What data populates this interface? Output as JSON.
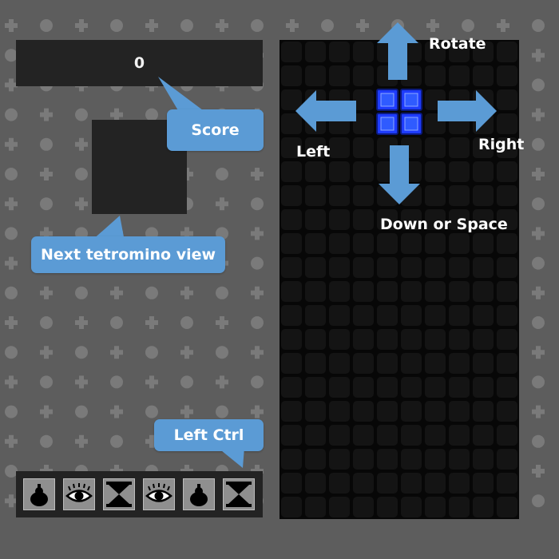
{
  "game": {
    "score": "0",
    "board": {
      "columns": 10,
      "rows": 20,
      "cell_color": "#141414",
      "empty_color": "#070707"
    },
    "active_piece": {
      "shape": "O",
      "color": "#1e3cff",
      "cells": [
        [
          4,
          2
        ],
        [
          5,
          2
        ],
        [
          4,
          3
        ],
        [
          5,
          3
        ]
      ]
    },
    "items": [
      {
        "name": "bomb"
      },
      {
        "name": "eye"
      },
      {
        "name": "hourglass"
      },
      {
        "name": "eye"
      },
      {
        "name": "bomb"
      },
      {
        "name": "hourglass"
      }
    ]
  },
  "callouts": {
    "score": "Score",
    "next": "Next tetromino view",
    "left_ctrl": "Left Ctrl"
  },
  "controls": {
    "rotate": "Rotate",
    "left": "Left",
    "right": "Right",
    "down": "Down or Space"
  },
  "colors": {
    "background": "#5d5d5d",
    "callout": "#5b9bd5",
    "panel": "#232323",
    "piece": "#1e3cff"
  }
}
